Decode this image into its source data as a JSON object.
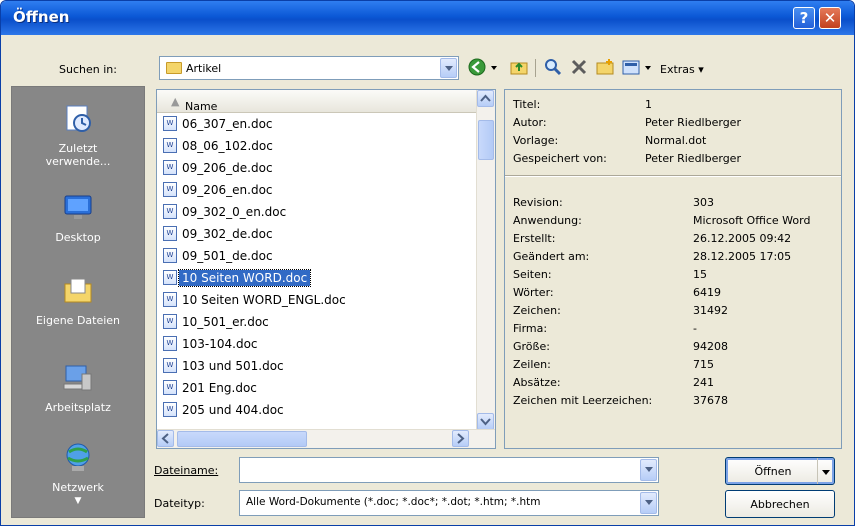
{
  "window": {
    "title": "Öffnen"
  },
  "titlebar": {
    "help_label": "?",
    "close_label": "✕"
  },
  "lookin": {
    "label": "Suchen in:",
    "value": "Artikel"
  },
  "toolbar": {
    "extras_label": "Extras"
  },
  "places": [
    {
      "label": "Zuletzt verwende...",
      "icon": "recent-documents-icon"
    },
    {
      "label": "Desktop",
      "icon": "desktop-icon"
    },
    {
      "label": "Eigene Dateien",
      "icon": "my-documents-icon"
    },
    {
      "label": "Arbeitsplatz",
      "icon": "my-computer-icon"
    },
    {
      "label": "Netzwerk",
      "icon": "network-icon"
    }
  ],
  "filelist": {
    "column_name": "Name",
    "files": [
      "06_307_en.doc",
      "08_06_102.doc",
      "09_206_de.doc",
      "09_206_en.doc",
      "09_302_0_en.doc",
      "09_302_de.doc",
      "09_501_de.doc",
      "10 Seiten WORD.doc",
      "10 Seiten WORD_ENGL.doc",
      "10_501_er.doc",
      "103-104.doc",
      "103 und 501.doc",
      "201 Eng.doc",
      "205 und 404.doc"
    ],
    "selected_index": 7
  },
  "properties": {
    "top": [
      {
        "key": "Titel:",
        "value": "1"
      },
      {
        "key": "Autor:",
        "value": "Peter Riedlberger"
      },
      {
        "key": "Vorlage:",
        "value": "Normal.dot"
      },
      {
        "key": "Gespeichert von:",
        "value": "Peter Riedlberger"
      }
    ],
    "bottom": [
      {
        "key": "Revision:",
        "value": "303"
      },
      {
        "key": "Anwendung:",
        "value": "Microsoft Office Word"
      },
      {
        "key": "Erstellt:",
        "value": "26.12.2005 09:42"
      },
      {
        "key": "Geändert am:",
        "value": "28.12.2005 17:05"
      },
      {
        "key": "Seiten:",
        "value": "15"
      },
      {
        "key": "Wörter:",
        "value": "6419"
      },
      {
        "key": "Zeichen:",
        "value": "31492"
      },
      {
        "key": "Firma:",
        "value": "-"
      },
      {
        "key": "Größe:",
        "value": "94208"
      },
      {
        "key": "Zeilen:",
        "value": "715"
      },
      {
        "key": "Absätze:",
        "value": "241"
      },
      {
        "key": "Zeichen mit Leerzeichen:",
        "value": "37678"
      }
    ]
  },
  "filename": {
    "label": "Dateiname:",
    "value": ""
  },
  "filetype": {
    "label": "Dateityp:",
    "value": "Alle Word-Dokumente (*.doc; *.doc*; *.dot; *.htm; *.htm"
  },
  "buttons": {
    "open_label": "Öffnen",
    "cancel_label": "Abbrechen"
  },
  "colors": {
    "title_blue": "#0b58d6",
    "selection": "#316ac5",
    "dialog_bg": "#ece9d8",
    "places_bg": "#878787"
  }
}
